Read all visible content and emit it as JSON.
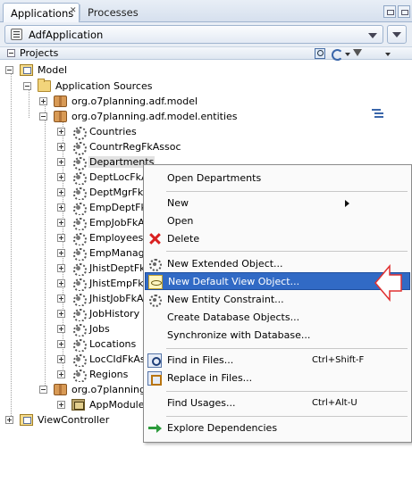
{
  "tabs": [
    {
      "label": "Applications",
      "active": true
    },
    {
      "label": "Processes",
      "active": false
    }
  ],
  "app_selector": {
    "value": "AdfApplication"
  },
  "projects_panel": {
    "title": "Projects"
  },
  "tree": {
    "model": "Model",
    "app_sources": "Application Sources",
    "pkg_model": "org.o7planning.adf.model",
    "pkg_entities": "org.o7planning.adf.model.entities",
    "entities": [
      "Countries",
      "CountrRegFkAssoc",
      "Departments",
      "DeptLocFkA",
      "DeptMgrFkA",
      "EmpDeptFkA",
      "EmpJobFkAs",
      "Employees",
      "EmpManage",
      "JhistDeptFk",
      "JhistEmpFkA",
      "JhistJobFkA",
      "JobHistory",
      "Jobs",
      "Locations",
      "LocCIdFkAs",
      "Regions"
    ],
    "pkg_other": "org.o7planning.",
    "app_module": "AppModule",
    "view_controller": "ViewController"
  },
  "context_menu": {
    "items": [
      {
        "label": "Open Departments"
      },
      {
        "label": "New"
      },
      {
        "label": "Open"
      },
      {
        "label": "Delete"
      },
      {
        "label": "New Extended Object..."
      },
      {
        "label": "New Default View Object..."
      },
      {
        "label": "New Entity Constraint..."
      },
      {
        "label": "Create Database Objects..."
      },
      {
        "label": "Synchronize with Database..."
      },
      {
        "label": "Find in Files...",
        "shortcut": "Ctrl+Shift-F"
      },
      {
        "label": "Replace in Files..."
      },
      {
        "label": "Find Usages...",
        "shortcut": "Ctrl+Alt-U"
      },
      {
        "label": "Explore Dependencies"
      }
    ],
    "highlighted": "New Default View Object..."
  },
  "colors": {
    "highlight": "#316ac5",
    "tab_border": "#9fb4cf",
    "pointer_outline": "#e03030"
  }
}
